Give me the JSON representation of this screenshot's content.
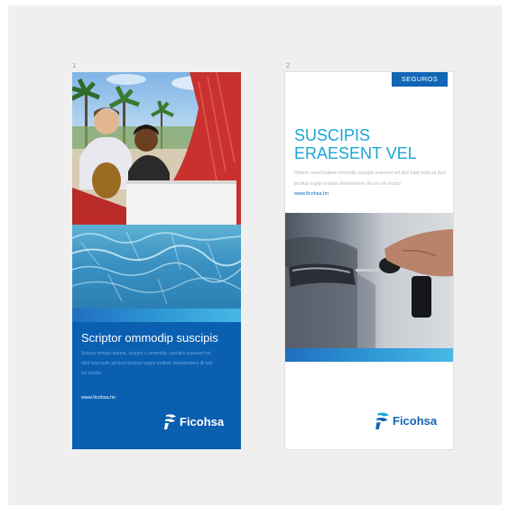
{
  "page_numbers": [
    "1",
    "2"
  ],
  "panel1": {
    "heading": "Scriptor ommodip suscipis",
    "body": "Suscus ermget animai, scriptor s ommodip, suscipis eraesent vel dipit lutat nulla ad dunt tincitud eugiat endiam delesandrem illi tuto vel incidui",
    "url": "www.ficohsa.hn",
    "logo_text": "Ficohsa",
    "photo_top": "couple-with-laptop-on-beach-photo",
    "photo_bottom": "pool-water-photo"
  },
  "panel2": {
    "badge": "SEGUROS",
    "heading_line1": "SUSCIPIS",
    "heading_line2": "ERAESENT VEL",
    "body": "Diatem sored nullane ommodip suscipis eraesent vel dipit lutat nulla ad dunt tincitud eugiat endiam delesandrem illi tuto vel incidui",
    "url": "www.ficohsa.hn",
    "photo": "car-key-hand-photo",
    "logo_text": "Ficohsa"
  },
  "colors": {
    "brand_blue": "#0b5fb0",
    "accent_cyan": "#1aa6d4",
    "badge_blue": "#1166b5"
  }
}
